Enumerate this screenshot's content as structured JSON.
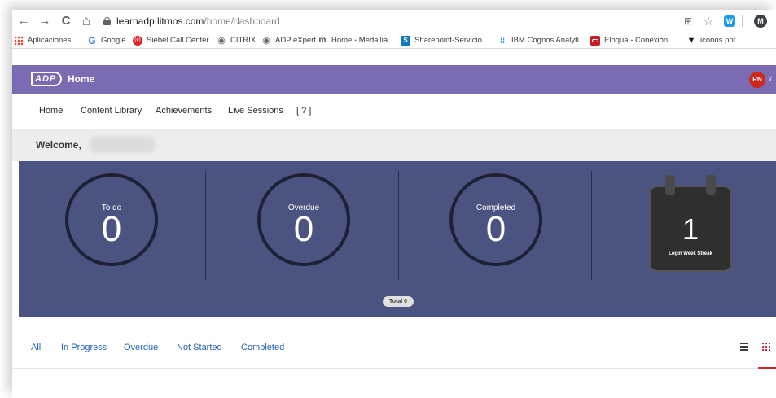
{
  "browser": {
    "url_host": "learnadp.litmos.com",
    "url_path": "/home/dashboard",
    "profile_initial": "M",
    "extension_label": "W",
    "nav_icons": {
      "back": "←",
      "forward": "→",
      "reload": "C",
      "home": "⌂"
    },
    "bookmarks": [
      {
        "label": "Aplicaciones",
        "icon": "apps-grid-icon"
      },
      {
        "label": "Google",
        "icon": "google-icon",
        "glyph": "G"
      },
      {
        "label": "Siebel Call Center",
        "icon": "siebel-icon",
        "glyph": "ⓞ"
      },
      {
        "label": "CITRIX",
        "icon": "globe-icon",
        "glyph": "◉"
      },
      {
        "label": "ADP eXpert",
        "icon": "globe-icon",
        "glyph": "◉"
      },
      {
        "label": "Home - Medallia",
        "icon": "medallia-icon",
        "glyph": "ṁ"
      },
      {
        "label": "Sharepoint-Servicio...",
        "icon": "sharepoint-icon",
        "glyph": "S"
      },
      {
        "label": "IBM Cognos Analyti...",
        "icon": "ibm-cognos-icon",
        "glyph": "⁞⁞"
      },
      {
        "label": "Eloqua - Conexión...",
        "icon": "eloqua-icon"
      },
      {
        "label": "iconos ppt",
        "icon": "funnel-icon",
        "glyph": "▼"
      }
    ]
  },
  "app": {
    "logo_text": "ADP",
    "title": "Home",
    "avatar_initials": "RN",
    "brand_color": "#7a6bb2"
  },
  "nav": {
    "items": [
      "Home",
      "Content Library",
      "Achievements",
      "Live Sessions",
      "[ ? ]"
    ]
  },
  "welcome": {
    "text": "Welcome,"
  },
  "stats": {
    "todo": {
      "label": "To do",
      "value": "0"
    },
    "overdue": {
      "label": "Overdue",
      "value": "0"
    },
    "completed": {
      "label": "Completed",
      "value": "0"
    },
    "streak": {
      "value": "1",
      "label": "Login Week Streak"
    },
    "total": "Total 0"
  },
  "filters": {
    "tabs": [
      "All",
      "In Progress",
      "Overdue",
      "Not Started",
      "Completed"
    ],
    "views": [
      "list-view-icon",
      "grid-view-icon"
    ]
  }
}
